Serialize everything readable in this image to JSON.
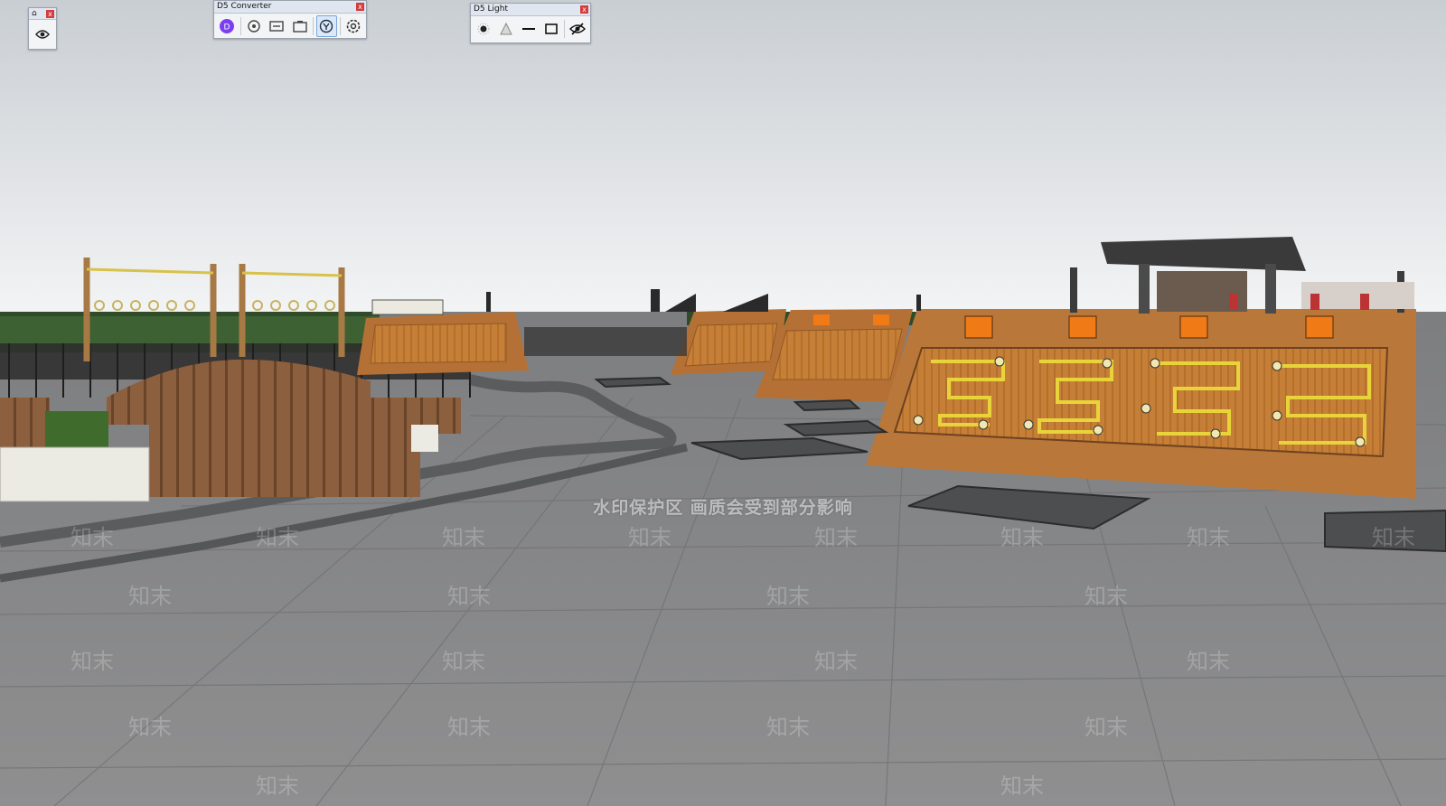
{
  "tag_toolbar": {
    "close_label": "x",
    "icons": [
      "tag-icon",
      "eye-icon"
    ]
  },
  "d5_converter": {
    "title": "D5 Converter",
    "close_label": "x",
    "icons": [
      "d5-logo-icon",
      "render-icon",
      "sync-icon",
      "camera-icon",
      "link-icon",
      "settings-icon"
    ]
  },
  "d5_light": {
    "title": "D5 Light",
    "close_label": "x",
    "icons": [
      "point-light-icon",
      "spot-light-icon",
      "strip-light-icon",
      "rect-light-icon",
      "hide-lights-icon"
    ]
  },
  "watermark": {
    "banner": "水印保护区   画质会受到部分影响",
    "text": "知末"
  },
  "colors": {
    "sky": "#eceef0",
    "pavement": "#8a8a8a",
    "wood": "#b9783a",
    "board_orange": "#f07a16",
    "fence_wood": "#8c5f3e",
    "toolbar_close": "#d43b3b"
  }
}
